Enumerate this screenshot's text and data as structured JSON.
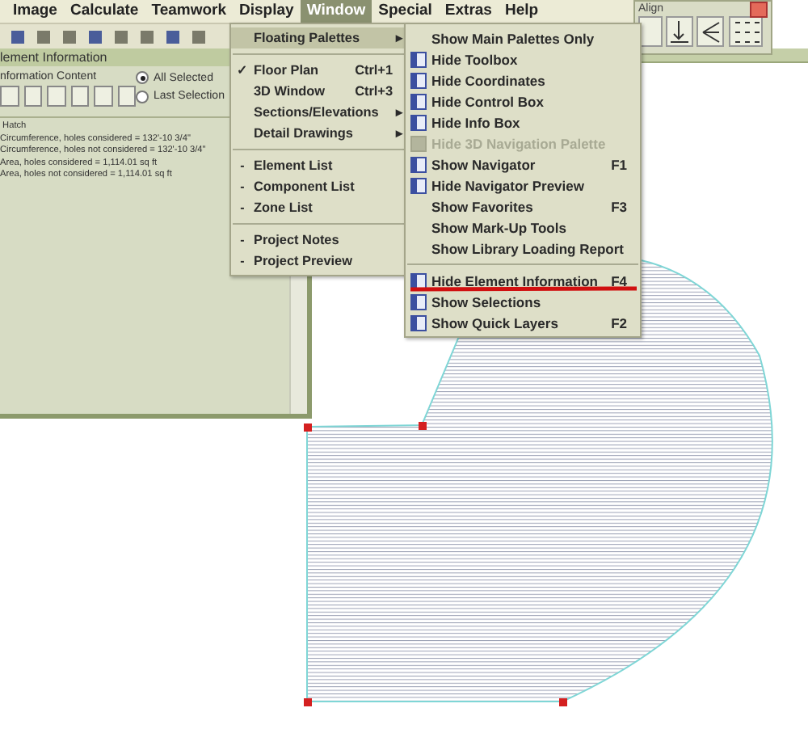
{
  "menubar": [
    {
      "label": "Image",
      "selected": false
    },
    {
      "label": "Calculate",
      "selected": false
    },
    {
      "label": "Teamwork",
      "selected": false
    },
    {
      "label": "Display",
      "selected": false
    },
    {
      "label": "Window",
      "selected": true
    },
    {
      "label": "Special",
      "selected": false
    },
    {
      "label": "Extras",
      "selected": false
    },
    {
      "label": "Help",
      "selected": false
    }
  ],
  "align_palette": {
    "title": "Align"
  },
  "info_palette": {
    "title": "lement Information",
    "content_label": "nformation Content",
    "radios": [
      {
        "label": "All Selected",
        "selected": true
      },
      {
        "label": "Last Selection",
        "selected": false
      }
    ],
    "lines": [
      " Hatch",
      "Circumference, holes considered = 132'-10 3/4\"",
      "Circumference, holes not considered = 132'-10 3/4\"",
      "Area, holes considered = 1,114.01 sq ft",
      "Area, holes not considered = 1,114.01 sq ft"
    ]
  },
  "window_menu": [
    {
      "kind": "item",
      "label": "Floating Palettes",
      "highlighted": true,
      "arrow": "▸"
    },
    {
      "kind": "separator"
    },
    {
      "kind": "item",
      "label": "Floor Plan",
      "shortcut": "Ctrl+1",
      "check": "✓",
      "highlighted": false
    },
    {
      "kind": "item",
      "label": "3D Window",
      "shortcut": "Ctrl+3",
      "highlighted": false
    },
    {
      "kind": "item",
      "label": "Sections/Elevations",
      "highlighted": false,
      "arrow": "▸"
    },
    {
      "kind": "item",
      "label": "Detail Drawings",
      "highlighted": false,
      "arrow": "▸"
    },
    {
      "kind": "separator"
    },
    {
      "kind": "item",
      "label": "Element List",
      "bullet": "-",
      "highlighted": false
    },
    {
      "kind": "item",
      "label": "Component List",
      "bullet": "-",
      "highlighted": false
    },
    {
      "kind": "item",
      "label": "Zone List",
      "bullet": "-",
      "highlighted": false
    },
    {
      "kind": "separator"
    },
    {
      "kind": "item",
      "label": "Project Notes",
      "bullet": "-",
      "highlighted": false
    },
    {
      "kind": "item",
      "label": "Project Preview",
      "bullet": "-",
      "highlighted": false
    }
  ],
  "palettes_submenu": [
    {
      "kind": "plain",
      "label": "Show Main Palettes Only",
      "disabled": false
    },
    {
      "kind": "icon",
      "label": "Hide Toolbox",
      "disabled": false
    },
    {
      "kind": "icon",
      "label": "Hide Coordinates",
      "disabled": false
    },
    {
      "kind": "icon",
      "label": "Hide Control Box",
      "disabled": false
    },
    {
      "kind": "icon",
      "label": "Hide Info Box",
      "disabled": false
    },
    {
      "kind": "icon",
      "label": "Hide 3D Navigation Palette",
      "disabled": true
    },
    {
      "kind": "icon",
      "label": "Show Navigator",
      "shortcut": "F1",
      "disabled": false
    },
    {
      "kind": "icon",
      "label": "Hide Navigator Preview",
      "disabled": false
    },
    {
      "kind": "plain",
      "label": "Show Favorites",
      "shortcut": "F3",
      "disabled": false
    },
    {
      "kind": "plain",
      "label": "Show Mark-Up Tools",
      "disabled": false
    },
    {
      "kind": "plain",
      "label": "Show Library Loading Report",
      "disabled": false
    },
    {
      "kind": "separator"
    },
    {
      "kind": "icon",
      "label": "Hide Element Information",
      "shortcut": "F4",
      "disabled": false,
      "marked": true
    },
    {
      "kind": "icon",
      "label": "Show Selections",
      "disabled": false
    },
    {
      "kind": "icon",
      "label": "Show Quick Layers",
      "shortcut": "F2",
      "disabled": false
    }
  ]
}
